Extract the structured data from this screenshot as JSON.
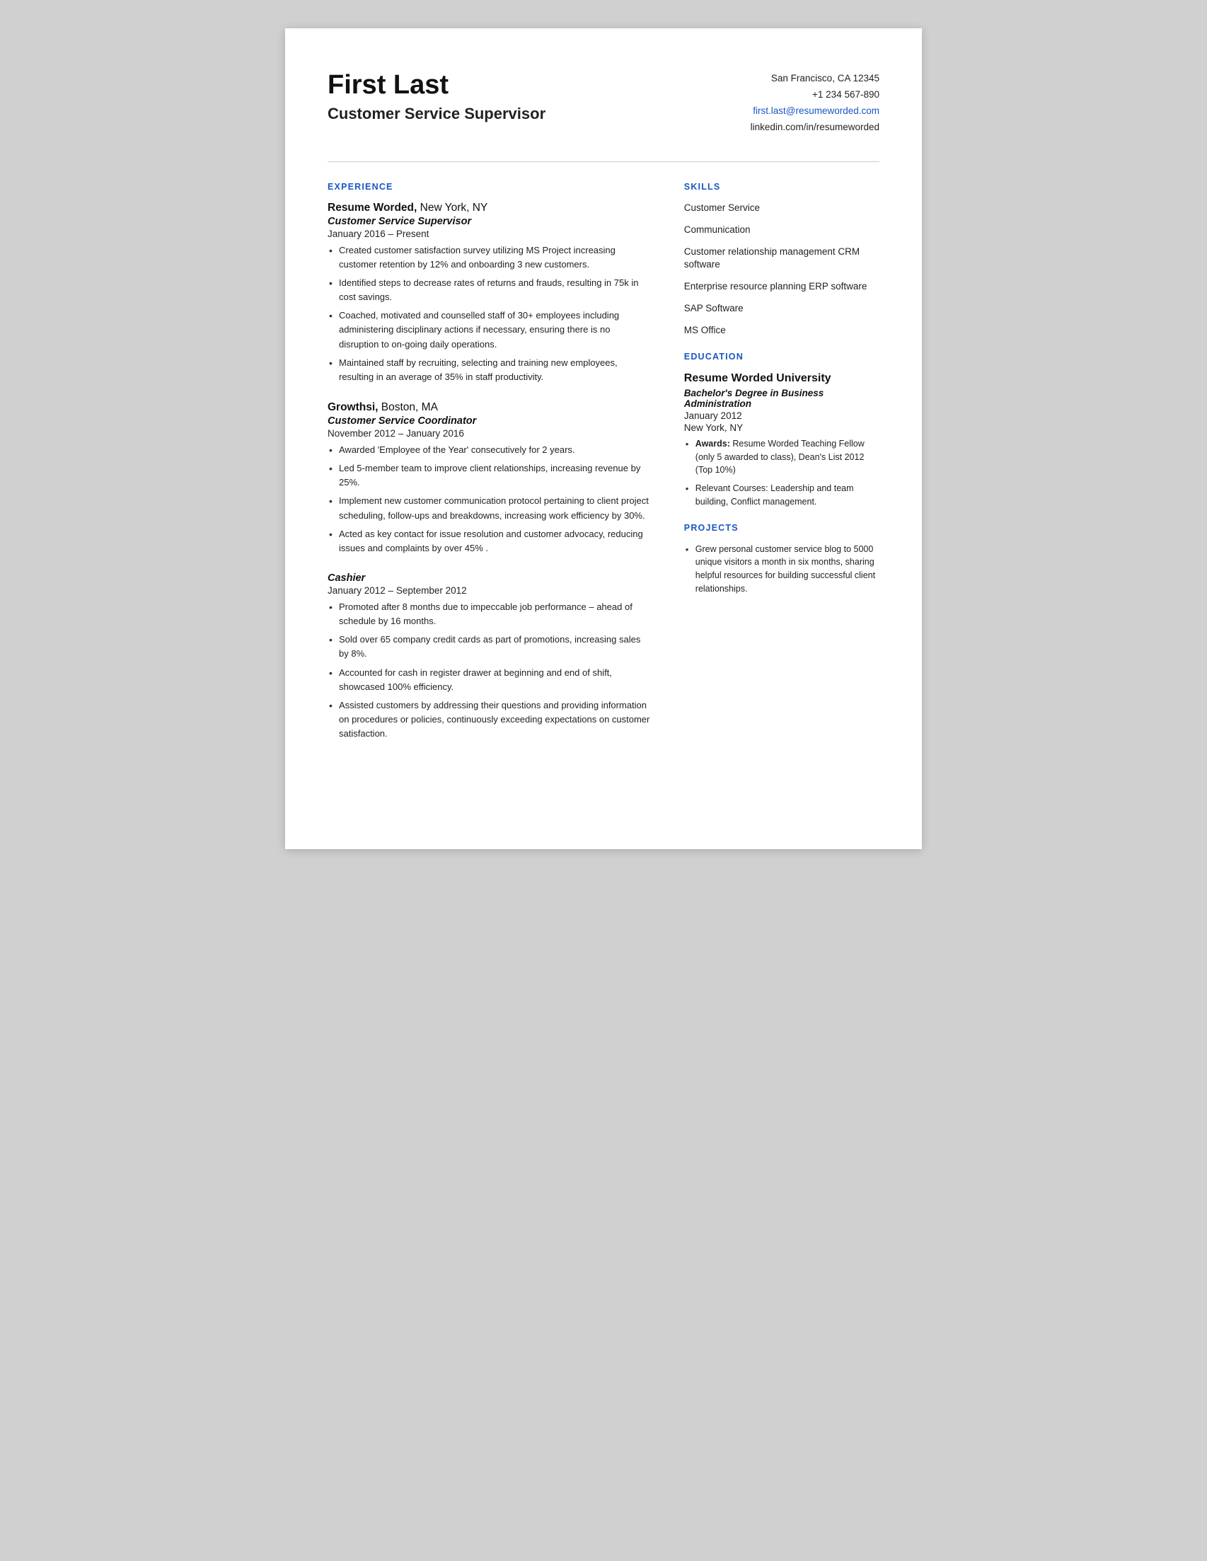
{
  "header": {
    "name": "First Last",
    "title": "Customer Service Supervisor",
    "address": "San Francisco, CA 12345",
    "phone": "+1 234 567-890",
    "email": "first.last@resumeworded.com",
    "linkedin": "linkedin.com/in/resumeworded"
  },
  "sections": {
    "experience_label": "EXPERIENCE",
    "skills_label": "SKILLS",
    "education_label": "EDUCATION",
    "projects_label": "PROJECTS"
  },
  "experience": [
    {
      "company": "Resume Worded",
      "location": "New York, NY",
      "role": "Customer Service Supervisor",
      "dates": "January 2016 – Present",
      "bullets": [
        "Created customer satisfaction survey utilizing MS Project increasing customer retention by 12% and onboarding 3 new customers.",
        "Identified steps to decrease rates of returns and frauds, resulting in 75k in cost savings.",
        "Coached, motivated and counselled staff of 30+ employees including administering disciplinary actions if necessary,  ensuring there is no disruption to on-going daily operations.",
        "Maintained staff by recruiting, selecting and training new employees, resulting in an average of 35% in staff productivity."
      ]
    },
    {
      "company": "Growthsi",
      "location": "Boston, MA",
      "role": "Customer Service Coordinator",
      "dates": "November 2012 – January 2016",
      "bullets": [
        "Awarded 'Employee of the Year' consecutively for 2 years.",
        "Led 5-member team to improve client relationships, increasing revenue by 25%.",
        "Implement new customer communication protocol pertaining to client project scheduling, follow-ups and breakdowns, increasing work efficiency by 30%.",
        "Acted as key contact for issue resolution and customer advocacy, reducing issues and complaints by over 45% ."
      ]
    },
    {
      "company": "",
      "location": "",
      "role": "Cashier",
      "dates": "January 2012 – September 2012",
      "bullets": [
        "Promoted after 8 months due to impeccable job performance – ahead of schedule by 16 months.",
        "Sold over 65 company credit cards as part of promotions, increasing sales by 8%.",
        "Accounted for cash in register drawer at beginning and end of shift, showcased 100% efficiency.",
        "Assisted customers by addressing their questions and providing information on procedures or policies, continuously exceeding expectations on customer satisfaction."
      ]
    }
  ],
  "skills": [
    "Customer Service",
    "Communication",
    "Customer relationship management CRM software",
    "Enterprise resource planning ERP software",
    "SAP Software",
    "MS Office"
  ],
  "education": {
    "school": "Resume Worded University",
    "degree": "Bachelor's Degree in Business Administration",
    "date": "January 2012",
    "location": "New York, NY",
    "bullets": [
      {
        "bold": "Awards:",
        "text": " Resume Worded Teaching Fellow (only 5 awarded to class), Dean's List 2012 (Top 10%)"
      },
      {
        "bold": "",
        "text": "Relevant Courses: Leadership and team building, Conflict management."
      }
    ]
  },
  "projects": [
    "Grew personal customer service  blog to 5000 unique visitors a month in six months, sharing helpful resources for building successful client relationships."
  ]
}
